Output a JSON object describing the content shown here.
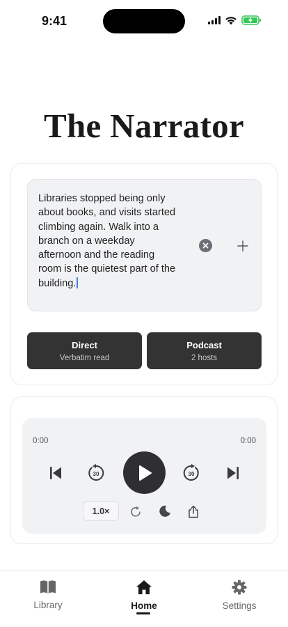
{
  "status_bar": {
    "time": "9:41"
  },
  "app": {
    "title": "The Narrator"
  },
  "composer": {
    "text": "Libraries stopped being only about books, and visits started climbing again. Walk into a branch on a weekday afternoon and the reading room is the quietest part of the building."
  },
  "modes": {
    "direct": {
      "title": "Direct",
      "subtitle": "Verbatim read"
    },
    "podcast": {
      "title": "Podcast",
      "subtitle": "2 hosts"
    }
  },
  "player": {
    "elapsed": "0:00",
    "duration": "0:00",
    "rewind_seconds": "30",
    "forward_seconds": "30",
    "speed": "1.0×"
  },
  "tabs": [
    {
      "label": "Library",
      "icon": "book-icon"
    },
    {
      "label": "Home",
      "icon": "house-icon"
    },
    {
      "label": "Settings",
      "icon": "gear-icon"
    }
  ],
  "colors": {
    "accent_dark": "#333333",
    "battery_green": "#34c759",
    "caret_blue": "#4b7be6"
  }
}
